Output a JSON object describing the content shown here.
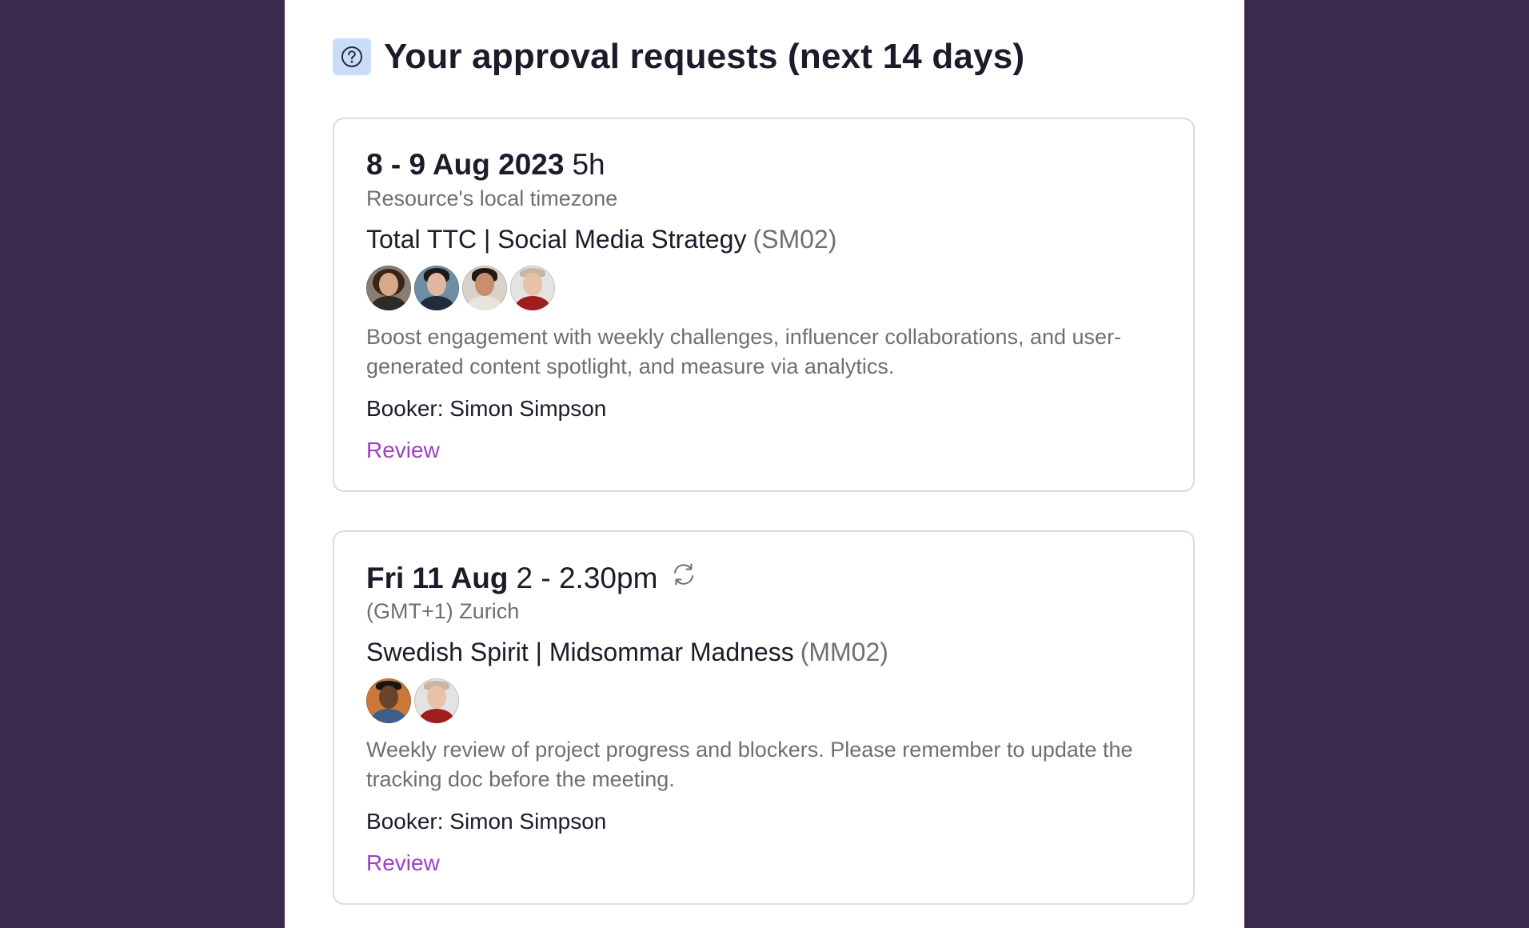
{
  "header": {
    "title": "Your approval requests (next 14 days)",
    "icon": "question-circle-icon"
  },
  "colors": {
    "page_background": "#3c2a4d",
    "panel_background": "#ffffff",
    "help_badge_background": "#c9dcf8",
    "link": "#9a3fc6",
    "text_primary": "#1b1b2a",
    "text_secondary": "#6f6f6f",
    "card_border": "#dcdcdc"
  },
  "requests": [
    {
      "date": "8 - 9 Aug 2023",
      "time": "5h",
      "timezone": "Resource's local timezone",
      "project_name": "Total TTC | Social Media Strategy",
      "project_code": "(SM02)",
      "avatars": [
        "avatar-1",
        "avatar-2",
        "avatar-3",
        "avatar-4"
      ],
      "description": "Boost engagement with weekly challenges, influencer collaborations, and user-generated content spotlight, and measure via analytics.",
      "booker": "Booker: Simon Simpson",
      "review_label": "Review",
      "recurring": false
    },
    {
      "date": "Fri 11 Aug",
      "time": "2 - 2.30pm",
      "timezone": "(GMT+1) Zurich",
      "project_name": "Swedish Spirit | Midsommar Madness",
      "project_code": "(MM02)",
      "avatars": [
        "avatar-5",
        "avatar-4"
      ],
      "description": "Weekly review of project progress and blockers. Please remember to update the tracking doc before the meeting.",
      "booker": "Booker: Simon Simpson",
      "review_label": "Review",
      "recurring": true,
      "recurring_icon": "repeat-icon"
    }
  ]
}
